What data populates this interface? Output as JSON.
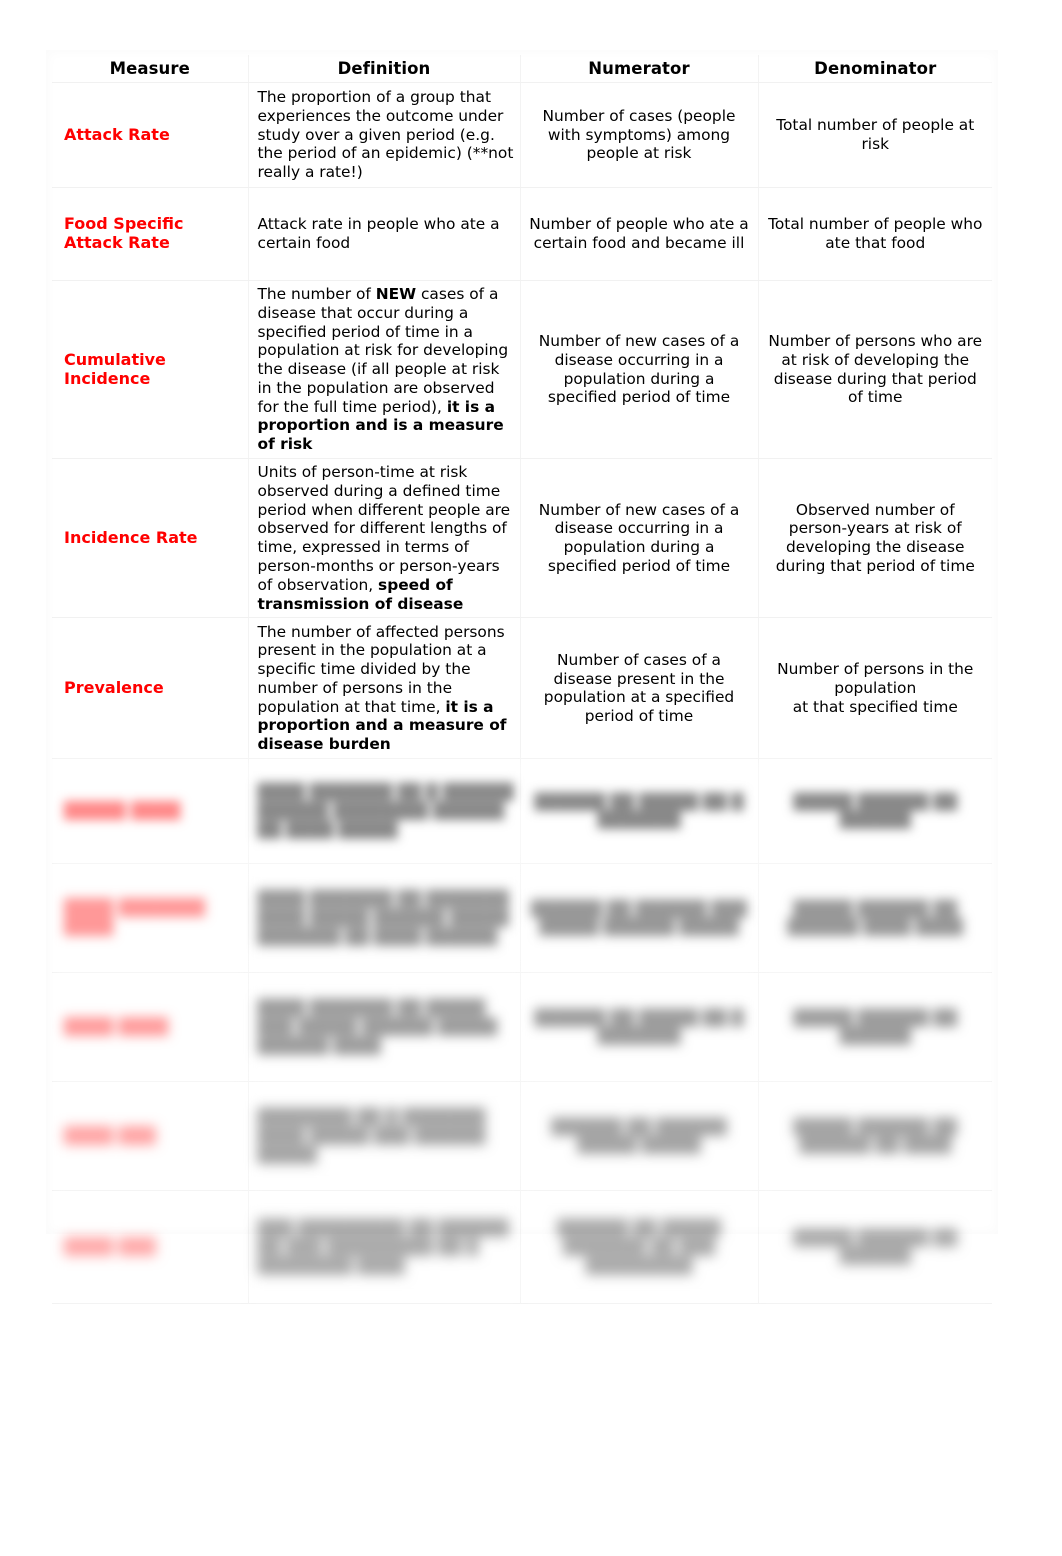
{
  "table": {
    "columns": [
      {
        "key": "measure",
        "label": "Measure"
      },
      {
        "key": "definition",
        "label": "Definition"
      },
      {
        "key": "numerator",
        "label": "Numerator"
      },
      {
        "key": "denominator",
        "label": "Denominator"
      }
    ],
    "accent_color": "#FF0000",
    "rows": [
      {
        "measure": "Attack Rate",
        "definition_plain": "The proportion of a group that experiences the outcome under study over a given period (e.g. the period of an epidemic) (**not really a rate!)",
        "definition_html": "The proportion of a group that experiences the outcome under study over a given period (e.g. the period of an epidemic) (**not really a rate!)",
        "numerator": "Number of cases (people with symptoms) among people at risk",
        "denominator": "Total number of people at risk"
      },
      {
        "measure": "Food Specific Attack Rate",
        "definition_plain": "Attack rate in people who ate a certain food",
        "definition_html": "Attack rate in people who ate a certain food",
        "numerator": "Number of people who ate a certain food and became ill",
        "denominator": "Total number of people who ate that food"
      },
      {
        "measure": "Cumulative Incidence",
        "definition_plain": "The number of NEW cases of a disease that occur during a specified period of time in a population at risk for developing the disease (if all people at risk in the population are observed for the full time period), it is a proportion and is a measure of risk",
        "definition_html": "The number of <b>NEW</b> cases of a disease that occur during a specified period of time in a population at risk for developing the disease (if all people at risk in the population are observed for the full time period), <b>it is a proportion and is a measure of risk</b>",
        "numerator": "Number of new cases of a disease occurring in a population during a specified period of time",
        "denominator": "Number of persons who are at risk of developing the disease during that period of time"
      },
      {
        "measure": "Incidence Rate",
        "definition_plain": "Units of person-time at risk observed during a defined time period when different people are observed for different lengths of time, expressed in terms of person-months or person-years of observation, speed of transmission of disease",
        "definition_html": "Units of person-time at risk observed during a defined time period when different people are observed for different lengths of time, expressed in terms of person-months or person-years of observation, <b>speed of transmission of disease</b>",
        "numerator": "Number of new cases of a disease occurring in a population during a specified period of time",
        "denominator": "Observed number of person-years at risk of developing the disease during that period of time"
      },
      {
        "measure": "Prevalence",
        "definition_plain": "The number of affected persons present in the population at a specific time divided by the number of persons in the population at that time, it is a proportion and a measure of disease burden",
        "definition_html": "The number of affected persons present in the population at a specific time divided by the number of persons in the population at that time, <b>it is a proportion and a measure of disease burden</b>",
        "numerator": "Number of cases of a disease present in the population at a specified period of time",
        "denominator": "Number of persons in the population<br>at that specified time"
      }
    ],
    "obscured_rows": [
      {
        "measure": "█████ ████",
        "definition_html": "████ ███████ ██ █ ██████ ██████ ████████ ██████ ██ ████ █████",
        "numerator": "██████ ██ █████ ██ █ ███████",
        "denominator": "█████ ██████ ██ ██████"
      },
      {
        "measure": "████ ███████ ████",
        "definition_html": "████ ███████ ██ ███████ ████ █████ ██████ █████ ███████ ██ ████ ██████",
        "numerator": "██████ ██ ██████ ███ █████ ██████ █████",
        "denominator": "█████ ██████ ██ ██████ ████ ████"
      },
      {
        "measure": "████ ████",
        "definition_html": "████ ███████ ██ █████ ███ █████ ██████ █████ ██████ ████",
        "numerator": "██████ ██ █████ ██ █ ███████",
        "denominator": "█████ ██████ ██ ██████"
      },
      {
        "measure": "████ ███",
        "definition_html": "████████ ██ █ ███████ ████ █████ ███ ██████ █████",
        "numerator": "██████ ██ ██████ █████ █████",
        "denominator": "█████ ██████ ██ ██████ ██ ████"
      },
      {
        "measure": "████ ███",
        "definition_html": "███ █████████ ██ ██████ ██ ███ █████████ ██ █ ████████ ████",
        "numerator": "██████ ██ █████ ███████ ██ ███ █████████",
        "denominator": "█████ ██████ ██ ██████"
      }
    ]
  }
}
